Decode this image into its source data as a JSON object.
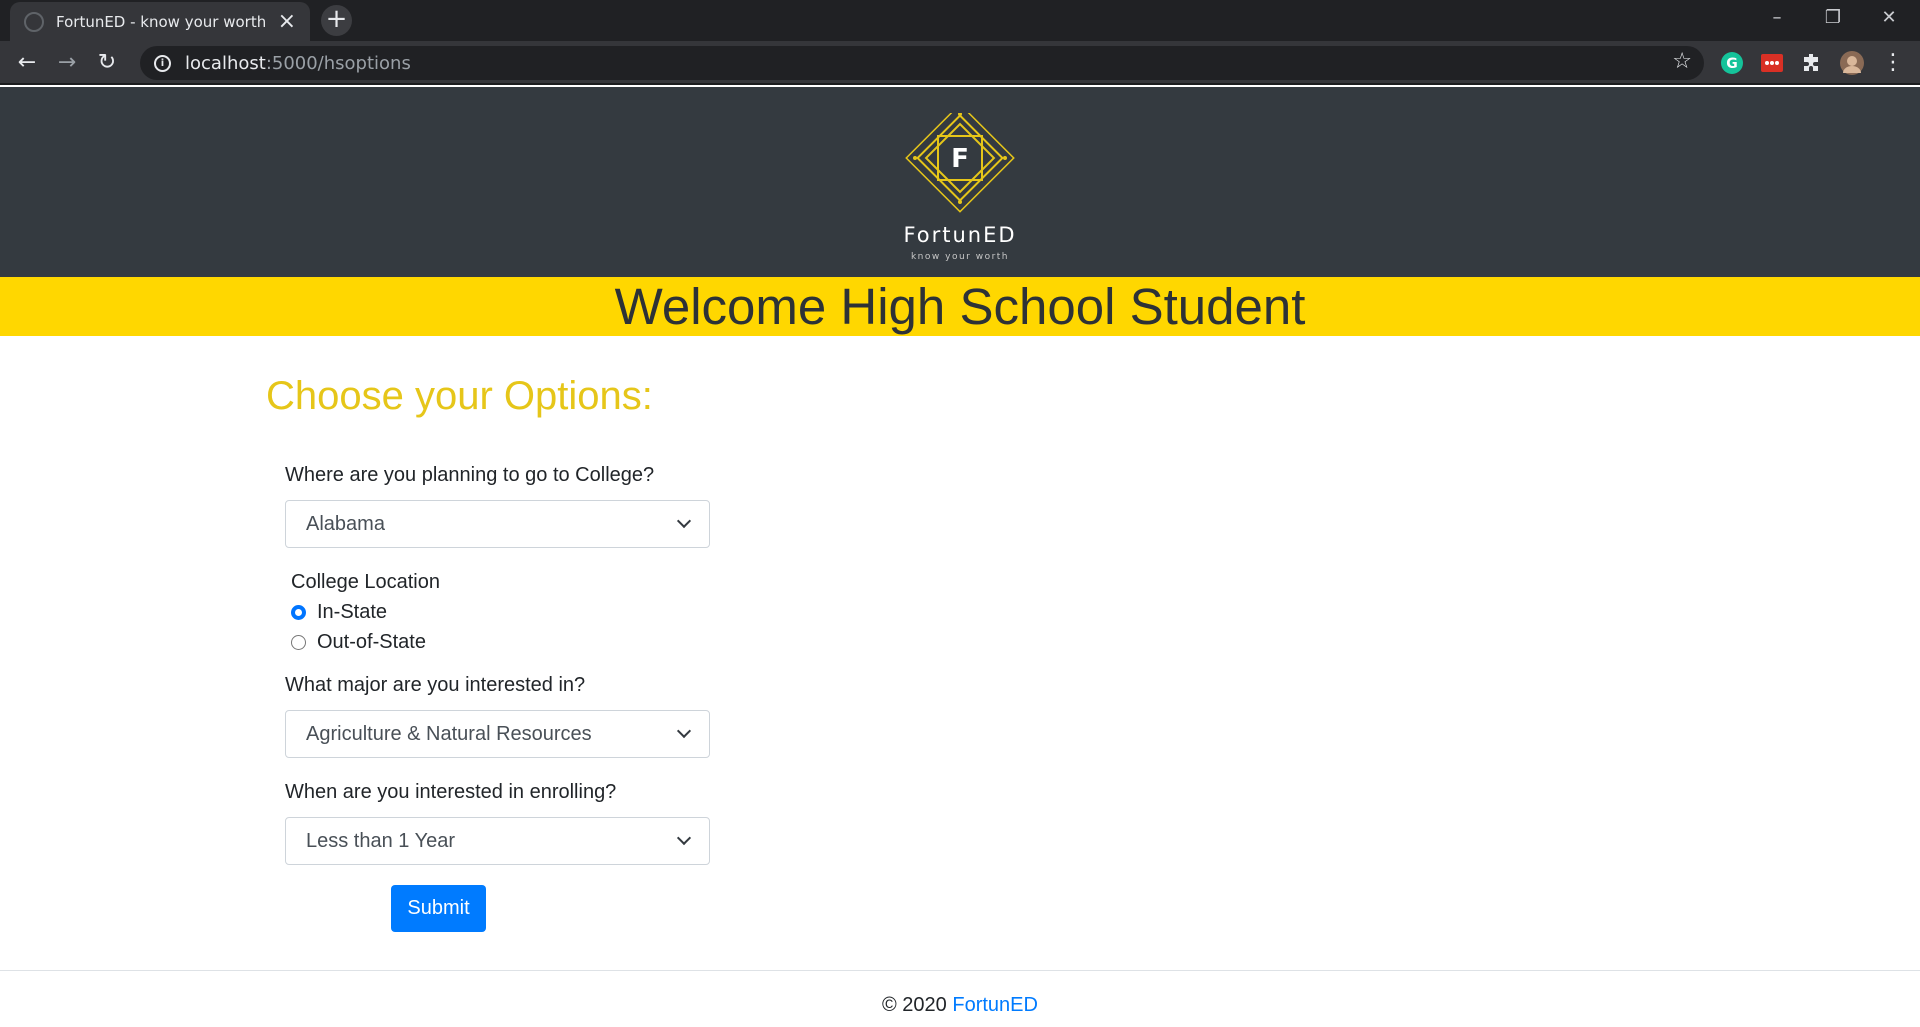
{
  "browser": {
    "tab_title": "FortunED - know your worth",
    "new_tab_icon": "plus-icon",
    "url_host": "localhost",
    "url_path": ":5000/hsoptions",
    "theme_color": "#202124"
  },
  "header": {
    "logo_letter": "F",
    "brand_name": "FortunED",
    "brand_tagline": "know your worth",
    "logo_color": "#e6c619",
    "welcome_title": "Welcome High School Student",
    "welcome_bar_color": "#ffd700"
  },
  "form": {
    "title": "Choose your Options:",
    "college_question": "Where are you planning to go to College?",
    "college_selected": "Alabama",
    "location_label": "College Location",
    "location_options": [
      {
        "label": "In-State",
        "checked": true
      },
      {
        "label": "Out-of-State",
        "checked": false
      }
    ],
    "major_question": "What major are you interested in?",
    "major_selected": "Agriculture & Natural Resources",
    "enroll_question": "When are you interested in enrolling?",
    "enroll_selected": "Less than 1 Year",
    "submit_label": "Submit"
  },
  "footer": {
    "copyright": "© 2020",
    "link_text": "FortunED"
  }
}
